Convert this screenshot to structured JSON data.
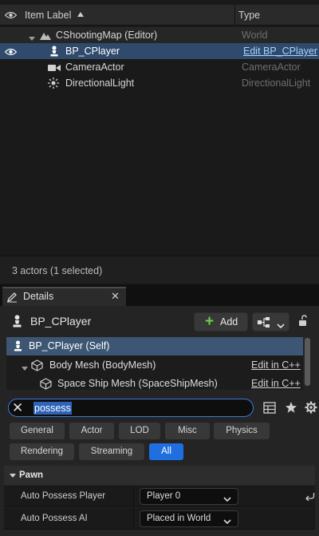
{
  "outliner": {
    "header": {
      "label_col": "Item Label",
      "type_col": "Type"
    },
    "rows": [
      {
        "label": "CShootingMap (Editor)",
        "type": "World"
      },
      {
        "label": "BP_CPlayer",
        "type": "Edit BP_CPlayer"
      },
      {
        "label": "CameraActor",
        "type": "CameraActor"
      },
      {
        "label": "DirectionalLight",
        "type": "DirectionalLight"
      }
    ],
    "status": "3 actors (1 selected)"
  },
  "details": {
    "tab_label": "Details",
    "actor_name": "BP_CPlayer",
    "add_label": "Add",
    "components": [
      {
        "label": "BP_CPlayer (Self)",
        "edit": ""
      },
      {
        "label": "Body Mesh (BodyMesh)",
        "edit": "Edit in C++"
      },
      {
        "label": "Space Ship Mesh (SpaceShipMesh)",
        "edit": "Edit in C++"
      }
    ],
    "search": {
      "value": "possess"
    },
    "filters": [
      "General",
      "Actor",
      "LOD",
      "Misc",
      "Physics",
      "Rendering",
      "Streaming",
      "All"
    ],
    "active_filter": "All",
    "category": "Pawn",
    "properties": [
      {
        "name": "Auto Possess Player",
        "value": "Player 0"
      },
      {
        "name": "Auto Possess AI",
        "value": "Placed in World"
      }
    ]
  },
  "colors": {
    "selection": "#2f4a6b",
    "accent_blue": "#1f6fe0",
    "add_green": "#6ad04a",
    "link_blue": "#a7d4ff"
  }
}
